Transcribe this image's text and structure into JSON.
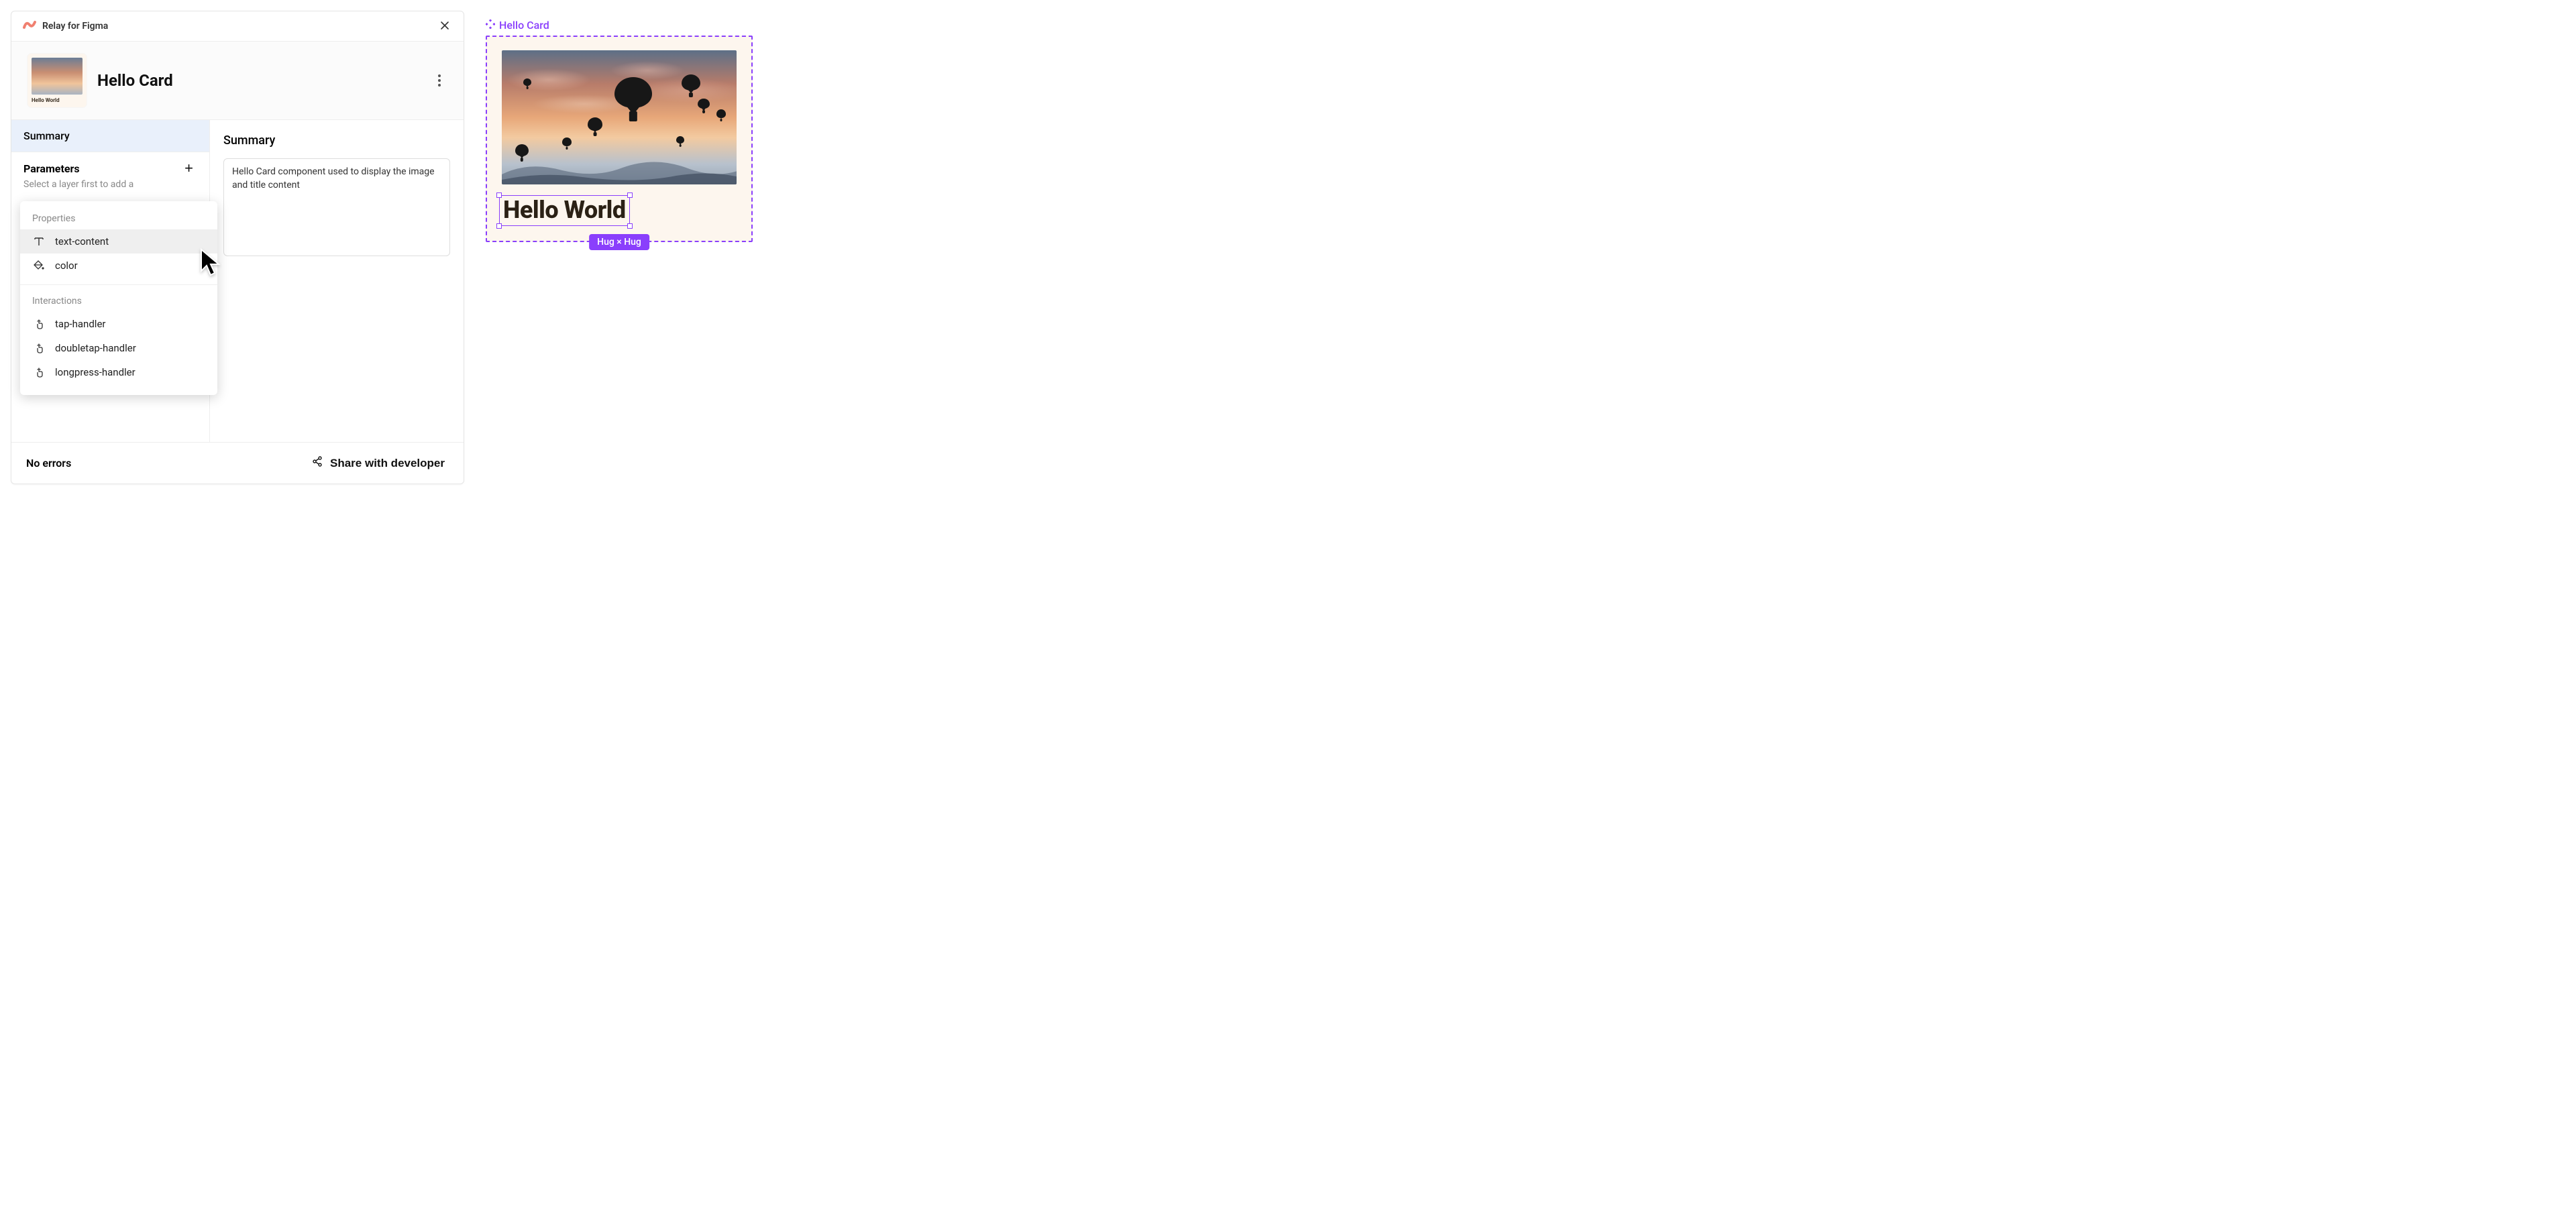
{
  "plugin": {
    "name": "Relay for Figma",
    "component_name": "Hello Card",
    "thumb_label": "Hello World",
    "tabs": {
      "summary": "Summary",
      "parameters": "Parameters"
    },
    "params_help": "Select a layer first to add a",
    "main_title": "Summary",
    "summary_text": "Hello Card component used to display the image and title content",
    "footer_errors": "No errors",
    "footer_share": "Share with developer"
  },
  "popover": {
    "section_properties": "Properties",
    "section_interactions": "Interactions",
    "items_properties": [
      "text-content",
      "color"
    ],
    "items_interactions": [
      "tap-handler",
      "doubletap-handler",
      "longpress-handler"
    ]
  },
  "canvas": {
    "label": "Hello Card",
    "title_text": "Hello World",
    "size_pill": "Hug × Hug"
  },
  "colors": {
    "figma_purple": "#8a3ffc",
    "card_bg": "#fdf6ee"
  }
}
